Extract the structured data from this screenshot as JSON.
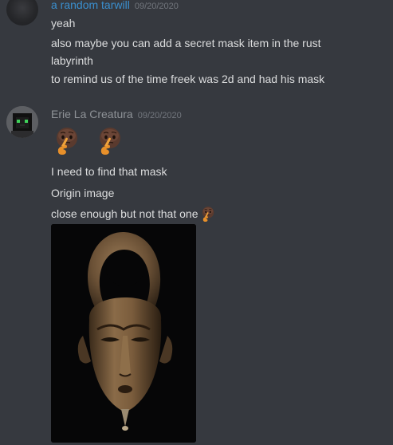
{
  "messages": [
    {
      "author": "a random tarwill",
      "timestamp": "09/20/2020",
      "lines": [
        "yeah",
        "also maybe you can add a secret mask item in the rust",
        "labyrinth",
        "to remind us of the time freek was 2d and had his mask"
      ]
    },
    {
      "author": "Erie La Creatura",
      "timestamp": "09/20/2020",
      "emoji_row": [
        "thinking-face-emoji",
        "thinking-face-emoji"
      ],
      "lines": [
        "I need to find that mask",
        "Origin image",
        "close enough but not that one"
      ],
      "inline_emoji": "thinking-face-emoji",
      "attachment": "carved-wooden-mask-image"
    }
  ],
  "colors": {
    "background": "#36393f",
    "author_1": "#3a8fcf",
    "author_2": "#8e9297",
    "text": "#dcddde",
    "timestamp": "#72767d"
  }
}
